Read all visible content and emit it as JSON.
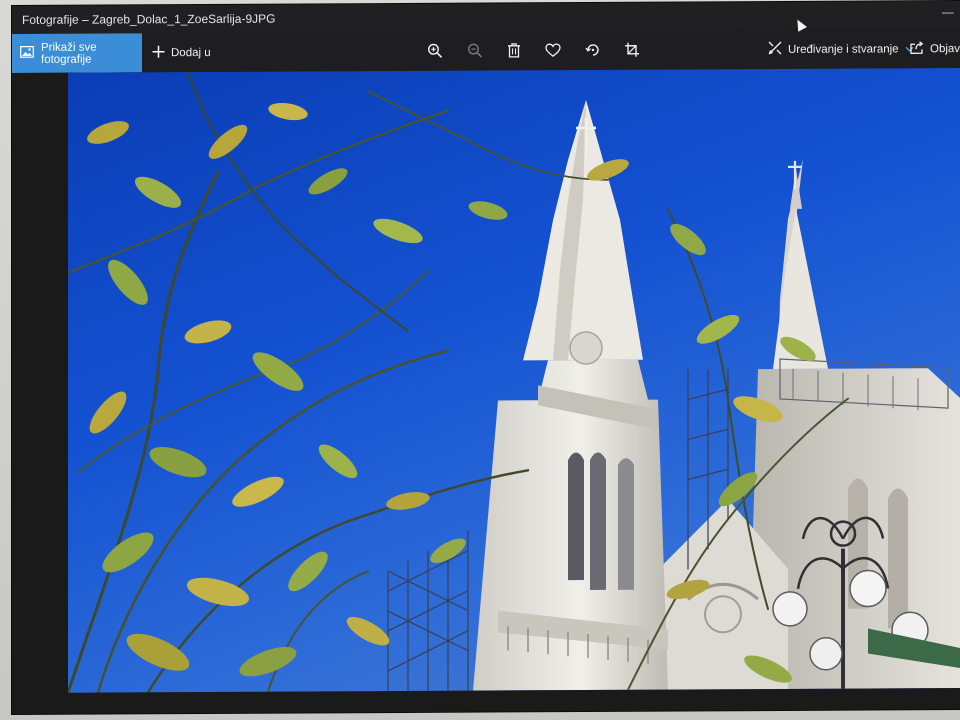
{
  "window": {
    "title": "Fotografije – Zagreb_Dolac_1_ZoeSarlija-9JPG"
  },
  "toolbar": {
    "show_all_label": "Prikaži sve fotografije",
    "add_label": "Dodaj u",
    "edit_label": "Uređivanje i stvaranje",
    "share_label": "Objavi"
  },
  "icons": {
    "show_all": "photo-icon",
    "add": "plus-icon",
    "zoom_in": "zoom-in-icon",
    "zoom_out": "zoom-out-icon",
    "delete": "trash-icon",
    "favorite": "heart-icon",
    "rotate": "rotate-icon",
    "crop": "crop-icon",
    "edit": "edit-create-icon",
    "edit_dropdown": "chevron-down-icon",
    "share": "share-icon"
  },
  "colors": {
    "accent": "#3a8dd6",
    "toolbar_bg": "#1e1e20",
    "sky": "#1452d2"
  }
}
